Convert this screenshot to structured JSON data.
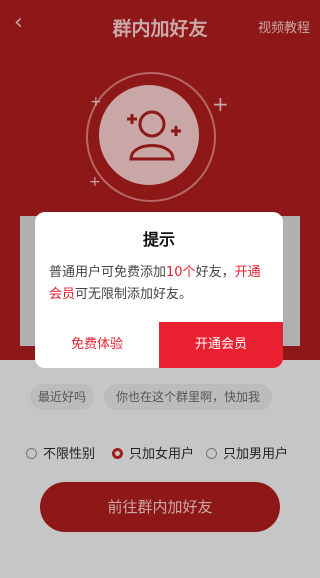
{
  "nav": {
    "back_icon": "chevron-left-icon",
    "title": "群内加好友",
    "help": "视频教程"
  },
  "hero": {
    "icon": "add-friends-icon"
  },
  "chips": [
    "最近好吗",
    "你也在这个群里啊，快加我"
  ],
  "gender": [
    {
      "label": "不限性别",
      "selected": false
    },
    {
      "label": "只加女用户",
      "selected": true
    },
    {
      "label": "只加男用户",
      "selected": false
    }
  ],
  "go_button": "前往群内加好友",
  "dialog": {
    "title": "提示",
    "msg_part1": "普通用户可免费添加",
    "msg_count": "10个",
    "msg_part2": "好友，",
    "msg_vip": "开通会员",
    "msg_part3": "可无限制添加好友。",
    "free_button": "免费体验",
    "vip_button": "开通会员"
  },
  "colors": {
    "brand_red": "#e8202f",
    "dark_red": "#8e1717"
  }
}
